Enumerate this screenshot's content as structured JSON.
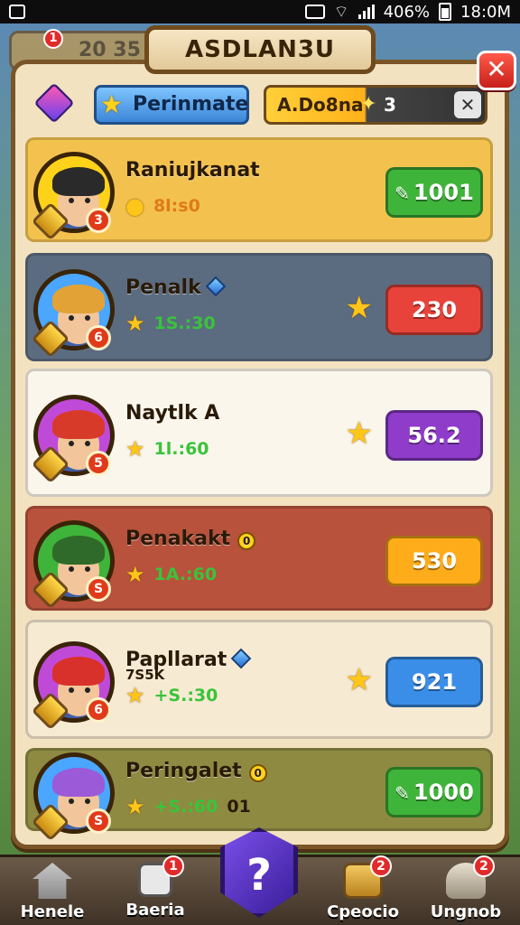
{
  "status_bar": {
    "battery_text": "406%",
    "time": "18:0M"
  },
  "background": {
    "badge_text": "20 35",
    "badge_notif": "1"
  },
  "panel": {
    "title": "ASDLAN3U",
    "close_label": "✕"
  },
  "tabs": {
    "primary_label": "Perinmate",
    "secondary_label": "A.Do8na",
    "secondary_count": "3",
    "secondary_close": "✕"
  },
  "players": [
    {
      "name": "Raniujkanat",
      "score": "8l:s0",
      "value": "1001",
      "value_icon": "ticket-icon",
      "bg": "#f3c24e",
      "button_color": "#3fb43a",
      "side_star": false,
      "avatar_ring": "#ffd21a",
      "hair": "#2a2a2a",
      "rank": "3"
    },
    {
      "name": "Penalk",
      "score": "1S.:30",
      "value": "230",
      "value_icon": "",
      "bg": "#5c6c80",
      "button_color": "#e8433a",
      "side_star": true,
      "avatar_ring": "#4aa6ff",
      "hair": "#e3a235",
      "rank": "6"
    },
    {
      "name": "Naytlk A",
      "score": "1l.:60",
      "value": "56.2",
      "value_icon": "",
      "bg": "#fbf6ec",
      "button_color": "#8e3cc9",
      "side_star": true,
      "avatar_ring": "#c04ad8",
      "hair": "#d83a2a",
      "rank": "5"
    },
    {
      "name": "Penakakt",
      "score": "1A.:60",
      "value": "530",
      "value_icon": "",
      "bg": "#b8523c",
      "button_color": "#ffac1a",
      "side_star": false,
      "avatar_ring": "#3fb43a",
      "hair": "#2f6a2a",
      "rank": "S"
    },
    {
      "name": "Papllarat",
      "score": "+S.:30",
      "score_top": "7S5K",
      "value": "921",
      "value_icon": "",
      "bg": "#f7ead2",
      "button_color": "#3a8ee8",
      "side_star": true,
      "avatar_ring": "#c04ad8",
      "hair": "#d8302a",
      "rank": "6"
    },
    {
      "name": "Peringalet",
      "score": "+S.:60",
      "score_suffix": "01",
      "value": "1000",
      "value_icon": "ticket-icon",
      "bg": "#8e8a42",
      "button_color": "#3fb43a",
      "side_star": false,
      "avatar_ring": "#4aa6ff",
      "hair": "#9b5ad8",
      "rank": "S"
    }
  ],
  "bottom_nav": [
    {
      "label": "Henele",
      "badge": ""
    },
    {
      "label": "Baeria",
      "badge": "1"
    },
    {
      "label": "Cpeocio",
      "badge": "2"
    },
    {
      "label": "Ungnob",
      "badge": "2"
    }
  ],
  "center_button_label": "?"
}
